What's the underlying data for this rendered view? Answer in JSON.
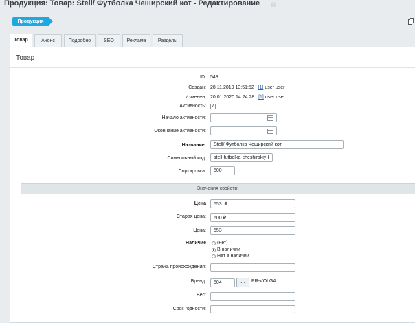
{
  "page": {
    "title": "Продукция: Товар: Stell/ Футболка Чеширский кот - Редактирование"
  },
  "toolbar": {
    "back_label": "Продукция"
  },
  "tabs": [
    {
      "label": "Товар"
    },
    {
      "label": "Анонс"
    },
    {
      "label": "Подробно"
    },
    {
      "label": "SEO"
    },
    {
      "label": "Реклама"
    },
    {
      "label": "Разделы"
    }
  ],
  "panel": {
    "title": "Товар"
  },
  "fields": {
    "id": {
      "label": "ID:",
      "value": "548"
    },
    "created": {
      "label": "Создан:",
      "date": "28.11.2019 13:51:52",
      "user_link": "[1]",
      "user": "user user"
    },
    "modified": {
      "label": "Изменен:",
      "date": "20.01.2020 14:24:28",
      "user_link": "[1]",
      "user": "user user"
    },
    "active": {
      "label": "Активность:",
      "checked": true,
      "mark": "✓"
    },
    "active_from": {
      "label": "Начало активности:",
      "value": ""
    },
    "active_to": {
      "label": "Окончание активности:",
      "value": ""
    },
    "name": {
      "label": "Название:",
      "value": "Stell/ Футболка Чеширский кот"
    },
    "code": {
      "label": "Символьный код:",
      "value": "stell-futbolka-cheshirskiy-kot"
    },
    "sort": {
      "label": "Сортировка:",
      "value": "500"
    }
  },
  "properties": {
    "section_title": "Значения свойств:",
    "price": {
      "label": "Цена",
      "value": "553  ₽"
    },
    "old_price": {
      "label": "Старая цена:",
      "value": "600 ₽"
    },
    "price2": {
      "label": "Цена:",
      "value": "553"
    },
    "availability": {
      "label": "Наличие",
      "options": [
        {
          "label": "(нет)",
          "selected": false
        },
        {
          "label": "В наличии",
          "selected": true
        },
        {
          "label": "Нет в наличии",
          "selected": false
        }
      ]
    },
    "country": {
      "label": "Страна происхождения:",
      "value": ""
    },
    "brand": {
      "label": "Бренд:",
      "value": "504",
      "button": "...",
      "name": "PR-VOLGA"
    },
    "weight": {
      "label": "Вес:",
      "value": ""
    },
    "shelf_life": {
      "label": "Срок годности:",
      "value": ""
    }
  }
}
